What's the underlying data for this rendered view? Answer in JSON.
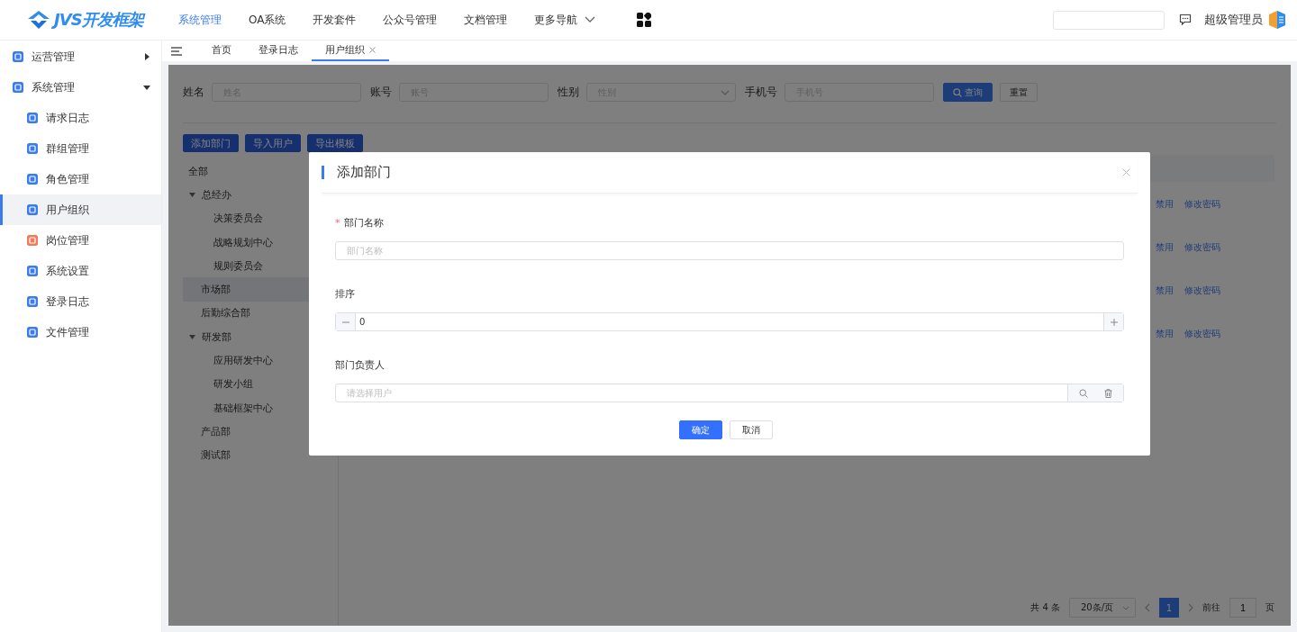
{
  "header": {
    "logo": "JVS开发框架",
    "nav": [
      {
        "label": "系统管理",
        "selected": true
      },
      {
        "label": "OA系统",
        "selected": false
      },
      {
        "label": "开发套件",
        "selected": false
      },
      {
        "label": "公众号管理",
        "selected": false
      },
      {
        "label": "文档管理",
        "selected": false
      }
    ],
    "more_nav": "更多导航",
    "user": "超级管理员"
  },
  "sidebar": {
    "items": [
      {
        "label": "运营管理",
        "expanded": false,
        "color": "#3a7bf0"
      },
      {
        "label": "系统管理",
        "expanded": true,
        "color": "#3a7bf0",
        "children": [
          {
            "label": "请求日志",
            "selected": false,
            "color": "#3a7bf0"
          },
          {
            "label": "群组管理",
            "selected": false,
            "color": "#3a7bf0"
          },
          {
            "label": "角色管理",
            "selected": false,
            "color": "#3a7bf0"
          },
          {
            "label": "用户组织",
            "selected": true,
            "color": "#3a7bf0"
          },
          {
            "label": "岗位管理",
            "selected": false,
            "color": "#f07a5a"
          },
          {
            "label": "系统设置",
            "selected": false,
            "color": "#3a7bf0"
          },
          {
            "label": "登录日志",
            "selected": false,
            "color": "#3a7bf0"
          },
          {
            "label": "文件管理",
            "selected": false,
            "color": "#3a7bf0"
          }
        ]
      }
    ]
  },
  "tabs": [
    {
      "label": "首页",
      "selected": false,
      "closable": false
    },
    {
      "label": "登录日志",
      "selected": false,
      "closable": false
    },
    {
      "label": "用户组织",
      "selected": true,
      "closable": true
    }
  ],
  "filters": [
    {
      "label": "姓名",
      "placeholder": "姓名",
      "kind": "text"
    },
    {
      "label": "账号",
      "placeholder": "账号",
      "kind": "text"
    },
    {
      "label": "性别",
      "placeholder": "性别",
      "kind": "select"
    },
    {
      "label": "手机号",
      "placeholder": "手机号",
      "kind": "text"
    }
  ],
  "filter_buttons": [
    {
      "label": "查询",
      "primary": true
    },
    {
      "label": "重置",
      "primary": false
    }
  ],
  "actions": [
    "添加部门",
    "导入用户",
    "导出模板"
  ],
  "tree": [
    {
      "label": "全部",
      "selected": false
    },
    {
      "label": "总经办",
      "expanded": true,
      "selected": false,
      "children": [
        {
          "label": "决策委员会",
          "selected": false
        },
        {
          "label": "战略规划中心",
          "selected": false
        },
        {
          "label": "规则委员会",
          "selected": false
        }
      ]
    },
    {
      "label": "市场部",
      "selected": true
    },
    {
      "label": "后勤综合部",
      "selected": false
    },
    {
      "label": "研发部",
      "expanded": true,
      "selected": false,
      "children": [
        {
          "label": "应用研发中心",
          "selected": false
        },
        {
          "label": "研发小组",
          "selected": false
        },
        {
          "label": "基础框架中心",
          "selected": false
        }
      ]
    },
    {
      "label": "产品部",
      "selected": false
    },
    {
      "label": "测试部",
      "selected": false
    }
  ],
  "table": {
    "rows": [
      {
        "actions": [
          "禁用",
          "修改密码"
        ]
      },
      {
        "actions": [
          "禁用",
          "修改密码"
        ]
      },
      {
        "actions": [
          "禁用",
          "修改密码"
        ]
      },
      {
        "actions": [
          "禁用",
          "修改密码"
        ]
      }
    ]
  },
  "pagination": {
    "total": "共 4 条",
    "page_size": "20条/页",
    "pages": [
      {
        "label": "1",
        "selected": true
      }
    ],
    "goto_label": "前往",
    "goto_value": "1",
    "goto_suffix": "页"
  },
  "dialog": {
    "title": "添加部门",
    "required_mark": "*",
    "fields": [
      {
        "kind": "text",
        "label": "部门名称",
        "required": true,
        "placeholder": "部门名称"
      },
      {
        "kind": "number",
        "label": "排序",
        "required": false,
        "value": "0"
      },
      {
        "kind": "picker",
        "label": "部门负责人",
        "required": false,
        "placeholder": "请选择用户"
      }
    ],
    "buttons": [
      {
        "label": "确定",
        "primary": true
      },
      {
        "label": "取消",
        "primary": false
      }
    ]
  }
}
